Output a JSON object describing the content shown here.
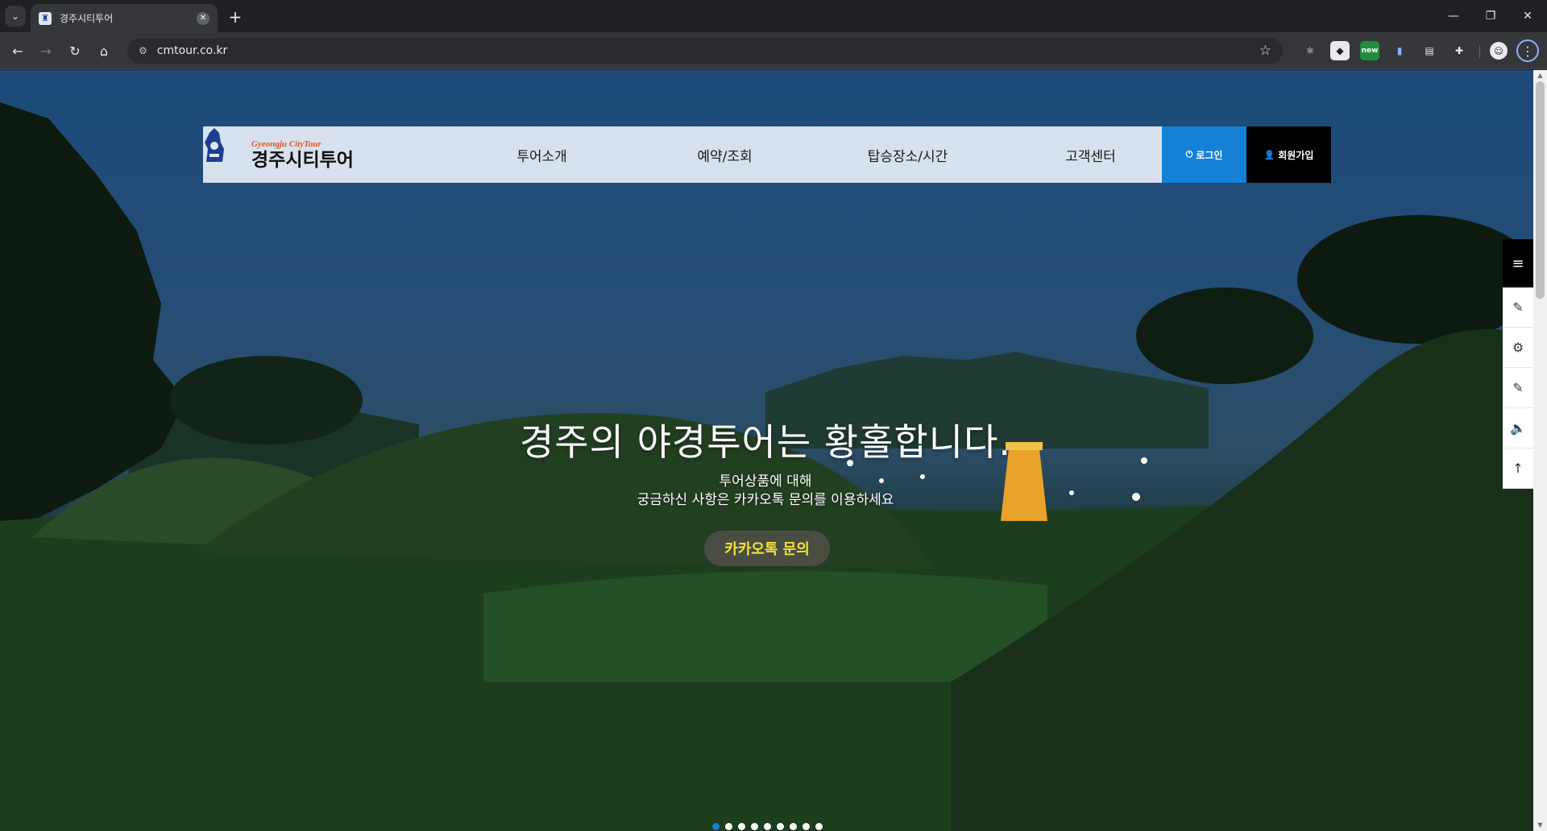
{
  "browser": {
    "tab_title": "경주시티투어",
    "tab_favicon": "city-tour-favicon",
    "url": "cmtour.co.kr",
    "ext_new_badge": "new"
  },
  "header": {
    "logo_en": "Gyeongju CityTour",
    "logo_ko": "경주시티투어",
    "nav": [
      "투어소개",
      "예약/조회",
      "탑승장소/시간",
      "고객센터"
    ],
    "login_label": "로그인",
    "join_label": "회원가입"
  },
  "hero": {
    "title": "경주의 야경투어는 황홀합니다.",
    "subtitle_line1": "투어상품에 대해",
    "subtitle_line2": "궁금하신 사항은 카카오톡 문의를 이용하세요",
    "kakao_button": "카카오톡 문의",
    "slide_count": 9,
    "active_slide": 1
  },
  "quick_menu": [
    "menu-icon",
    "edit-icon",
    "settings-gears-icon",
    "edit-icon",
    "speaker-icon",
    "arrow-up-icon"
  ],
  "colors": {
    "login_blue": "#1580d6",
    "join_black": "#000000",
    "kakao_yellow": "#f5e33b",
    "header_bg": "#dfe8f3"
  }
}
